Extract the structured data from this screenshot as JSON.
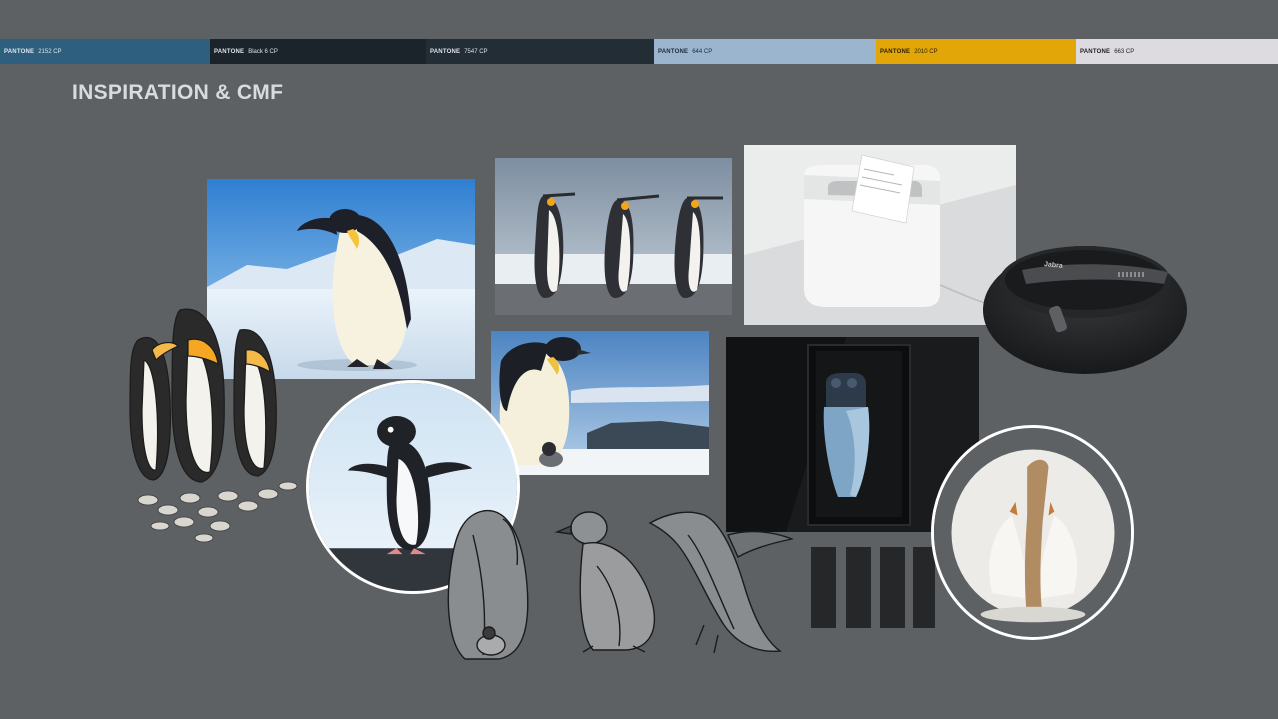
{
  "page": {
    "title": "INSPIRATION & CMF",
    "background": "#5d6163"
  },
  "palette": {
    "brand": "PANTONE",
    "swatches": [
      {
        "code": "2152 CP",
        "color": "#2f5f7f",
        "text_color": "#dde6ee"
      },
      {
        "code": "Black 6 CP",
        "color": "#1b232b",
        "text_color": "#dfe3e7"
      },
      {
        "code": "7547 CP",
        "color": "#222d35",
        "text_color": "#dfe3e7"
      },
      {
        "code": "644 CP",
        "color": "#9cb5cf",
        "text_color": "#1d2a38"
      },
      {
        "code": "2010 CP",
        "color": "#e2a609",
        "text_color": "#2a2200"
      },
      {
        "code": "663 CP",
        "color": "#dedbe0",
        "text_color": "#202022"
      }
    ]
  },
  "images": {
    "emperor_penguin": "emperor-penguin-on-ice-photo",
    "king_penguins_trio": "three-king-penguins-photo",
    "tissue_box": "white-tissue-box-product-photo",
    "jabra_dock": {
      "brand_mark": "Jabra"
    },
    "penguin_with_chick": "penguin-with-chick-photo",
    "shaver": "blue-electric-shaver-product-photo",
    "adelie_circle": "adelie-penguin-circle-photo",
    "ceramic_circle": "ceramic-penguin-sculpture-circle-photo",
    "illustrated_group": "illustrated-penguin-group",
    "sketches": [
      "penguin-with-chick-sketch",
      "penguin-chick-sketch",
      "diving-penguin-sketch"
    ],
    "material_tiles": 4
  }
}
